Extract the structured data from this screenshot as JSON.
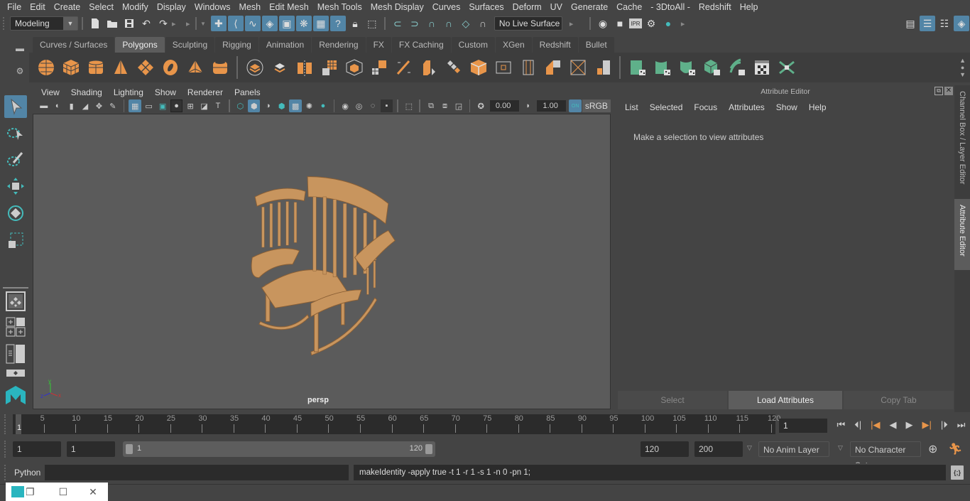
{
  "menubar": {
    "items": [
      "File",
      "Edit",
      "Create",
      "Select",
      "Modify",
      "Display",
      "Windows",
      "Mesh",
      "Edit Mesh",
      "Mesh Tools",
      "Mesh Display",
      "Curves",
      "Surfaces",
      "Deform",
      "UV",
      "Generate",
      "Cache",
      "- 3DtoAll -",
      "Redshift",
      "Help"
    ]
  },
  "statusline": {
    "menuset": "Modeling",
    "live_surface": "No Live Surface",
    "icons": [
      "new-scene-icon",
      "open-scene-icon",
      "save-scene-icon",
      "undo-icon",
      "redo-icon"
    ],
    "snap_icons": [
      "snap-grid-icon",
      "snap-curve-icon",
      "snap-point-icon",
      "snap-view-plane-icon",
      "snap-projected-center-icon",
      "symmetry-icon",
      "render-view-icon",
      "help-icon"
    ],
    "render_icons": [
      "render-frame-icon",
      "render-current-icon",
      "ipr-render-icon",
      "render-settings-icon",
      "hypershade-icon"
    ],
    "ipr_label": "IPR"
  },
  "shelf": {
    "tabs": [
      "Curves / Surfaces",
      "Polygons",
      "Sculpting",
      "Rigging",
      "Animation",
      "Rendering",
      "FX",
      "FX Caching",
      "Custom",
      "XGen",
      "Redshift",
      "Bullet"
    ],
    "active_tab": "Polygons",
    "icons": [
      "poly-sphere-icon",
      "poly-cube-icon",
      "poly-cylinder-icon",
      "poly-cone-icon",
      "poly-plane-icon",
      "poly-torus-icon",
      "poly-pyramid-icon",
      "poly-pipe-icon",
      "combine-icon",
      "separate-icon",
      "extract-icon",
      "smooth-icon",
      "poly-cube-wire-icon",
      "extrude-icon",
      "multi-cut-icon",
      "bevel-icon",
      "bridge-icon",
      "target-weld-icon",
      "insert-edge-loop-icon",
      "offset-edge-loop-icon",
      "append-polygon-icon",
      "fill-hole-icon",
      "planar-uv-icon",
      "cylindrical-uv-icon",
      "spherical-uv-icon",
      "automatic-uv-icon",
      "unfold-uv-icon",
      "uv-editor-icon",
      "uv-cut-sew-icon"
    ]
  },
  "viewport": {
    "menus": [
      "View",
      "Shading",
      "Lighting",
      "Show",
      "Renderer",
      "Panels"
    ],
    "exposure": "0.00",
    "gamma": "1.00",
    "color_mgmt_label": "ON",
    "color_space": "sRGB",
    "camera_label": "persp",
    "axis": {
      "x": "x",
      "y": "y",
      "z": "z"
    }
  },
  "attribute_editor": {
    "title": "Attribute Editor",
    "menus": [
      "List",
      "Selected",
      "Focus",
      "Attributes",
      "Show",
      "Help"
    ],
    "message": "Make a selection to view attributes",
    "buttons": {
      "select": "Select",
      "load": "Load Attributes",
      "copy": "Copy Tab"
    }
  },
  "side_tabs": {
    "channel_box": "Channel Box / Layer Editor",
    "attribute_editor": "Attribute Editor"
  },
  "timeline": {
    "ticks": [
      5,
      10,
      15,
      20,
      25,
      30,
      35,
      40,
      45,
      50,
      55,
      60,
      65,
      70,
      75,
      80,
      85,
      90,
      95,
      100,
      105,
      110,
      115,
      120
    ],
    "range_start": 1,
    "range_end": 120,
    "current_frame_marker": "1",
    "current_frame": "1"
  },
  "range": {
    "start_time": "1",
    "playback_start": "1",
    "slider_start": "1",
    "slider_end": "120",
    "playback_end": "120",
    "end_time": "200",
    "anim_layer": "No Anim Layer",
    "character_set": "No Character Set"
  },
  "command_line": {
    "language": "Python",
    "input": "",
    "output": "makeIdentity -apply true -t 1 -r 1 -s 1 -n 0 -pn 1;"
  },
  "colors": {
    "accent": "#5285a6",
    "shelf_poly": "#e8954a",
    "shelf_uv": "#5fb08a",
    "viewport_bg": "#5b5b5b",
    "panel_bg": "#444444",
    "field_bg": "#2b2b2b"
  }
}
